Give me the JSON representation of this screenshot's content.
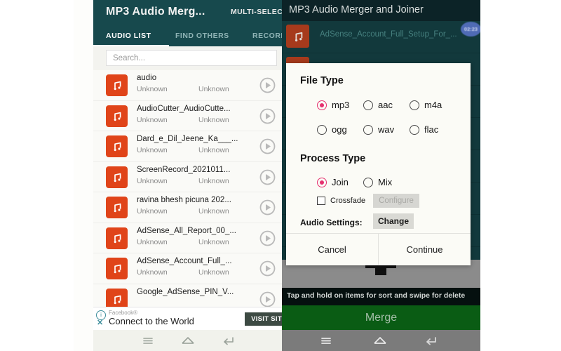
{
  "left": {
    "app_title": "MP3 Audio Merg...",
    "multiselect_label": "MULTI-SELECT",
    "tabs": [
      {
        "label": "AUDIO LIST",
        "active": true
      },
      {
        "label": "FIND OTHERS",
        "active": false
      },
      {
        "label": "RECORD",
        "active": false
      }
    ],
    "search": {
      "placeholder": "Search...",
      "value": ""
    },
    "list": [
      {
        "title": "audio",
        "sub1": "Unknown",
        "sub2": "Unknown"
      },
      {
        "title": "AudioCutter_AudioCutte...",
        "sub1": "Unknown",
        "sub2": "Unknown"
      },
      {
        "title": "Dard_e_Dil_Jeene_Ka___...",
        "sub1": "Unknown",
        "sub2": "Unknown"
      },
      {
        "title": "ScreenRecord_2021011...",
        "sub1": "Unknown",
        "sub2": "Unknown"
      },
      {
        "title": "ravina bhesh picuna 202...",
        "sub1": "Unknown",
        "sub2": "Unknown"
      },
      {
        "title": "AdSense_All_Report_00_...",
        "sub1": "Unknown",
        "sub2": "Unknown"
      },
      {
        "title": "AdSense_Account_Full_...",
        "sub1": "Unknown",
        "sub2": "Unknown"
      },
      {
        "title": "Google_AdSense_PIN_V...",
        "sub1": "",
        "sub2": ""
      }
    ],
    "ad": {
      "brand": "Facebook®",
      "headline": "Connect to the World",
      "cta": "VISIT SIT",
      "info_glyph": "i"
    }
  },
  "right": {
    "app_title": "MP3 Audio Merger and Joiner",
    "selected_item": {
      "title": "AdSense_Account_Full_Setup_For_...",
      "badge": "02:23"
    },
    "hint": "Tap and hold on items for sort and swipe for delete",
    "merge_label": "Merge"
  },
  "dialog": {
    "file_type": {
      "heading": "File Type",
      "options": [
        {
          "label": "mp3",
          "selected": true
        },
        {
          "label": "aac",
          "selected": false
        },
        {
          "label": "m4a",
          "selected": false
        },
        {
          "label": "ogg",
          "selected": false
        },
        {
          "label": "wav",
          "selected": false
        },
        {
          "label": "flac",
          "selected": false
        }
      ]
    },
    "process_type": {
      "heading": "Process Type",
      "options": [
        {
          "label": "Join",
          "selected": true
        },
        {
          "label": "Mix",
          "selected": false
        }
      ],
      "crossfade": {
        "label": "Crossfade",
        "checked": false
      },
      "configure_button": "Configure"
    },
    "audio_settings": {
      "label": "Audio Settings:",
      "button": "Change"
    },
    "cancel_button": "Cancel",
    "continue_button": "Continue"
  },
  "colors": {
    "teal_appbar": "#17494d",
    "orange_icon": "#e04419",
    "accent_pink": "#e5306e",
    "merge_green": "#0a5c14"
  }
}
